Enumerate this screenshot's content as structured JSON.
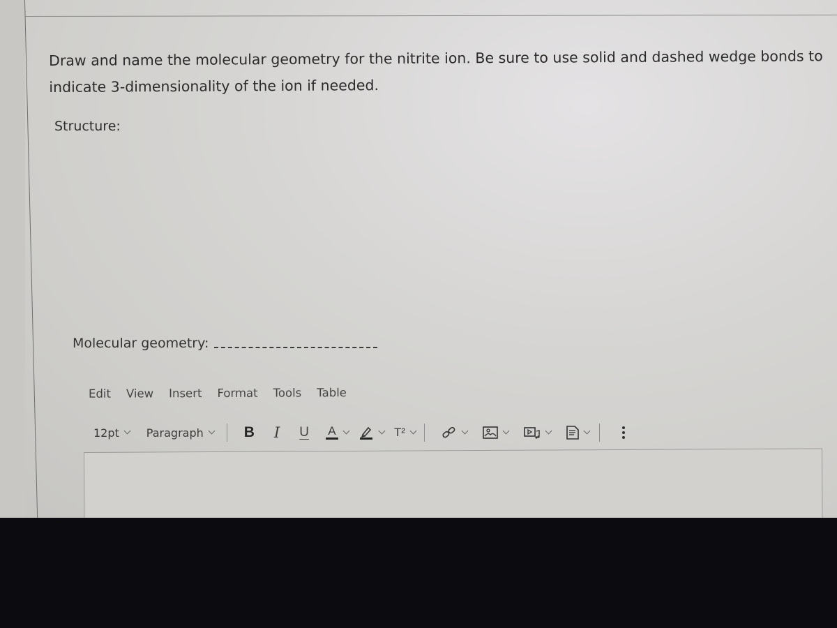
{
  "question": {
    "line1": "Draw and name the molecular geometry for the nitrite ion.  Be sure to use solid and dashed wedge bonds to",
    "line2": "indicate 3-dimensionality of the ion if needed."
  },
  "labels": {
    "structure": "Structure:",
    "molecular_geometry": "Molecular geometry:"
  },
  "editor": {
    "menu": [
      "Edit",
      "View",
      "Insert",
      "Format",
      "Tools",
      "Table"
    ],
    "toolbar": {
      "font_size": "12pt",
      "block_format": "Paragraph",
      "bold": "B",
      "italic": "I",
      "underline": "U",
      "text_color": "A",
      "superscript": "T²",
      "icons": [
        "link-icon",
        "image-icon",
        "media-icon",
        "document-icon",
        "more-options-icon"
      ]
    },
    "content": ""
  }
}
